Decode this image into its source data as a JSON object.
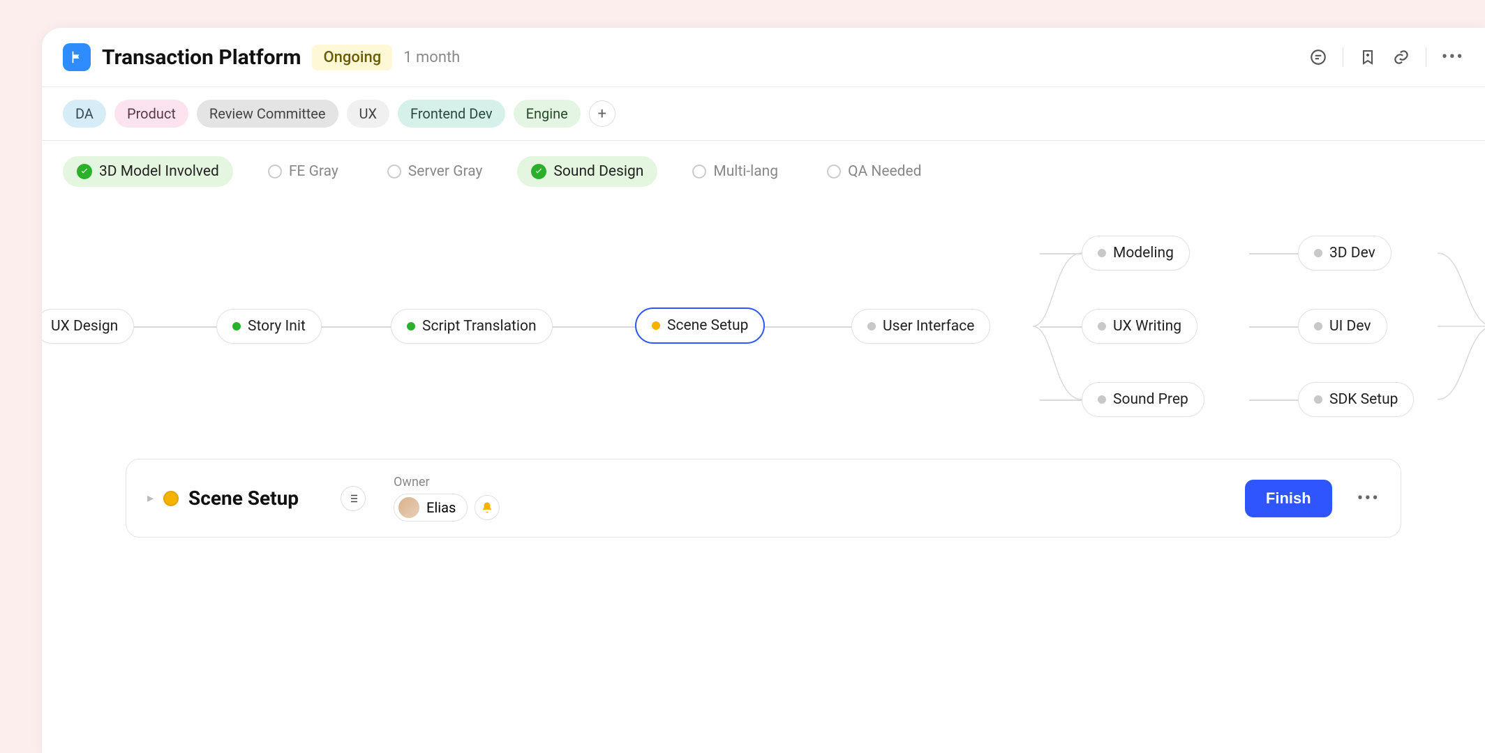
{
  "header": {
    "title": "Transaction Platform",
    "status": "Ongoing",
    "duration": "1 month"
  },
  "tags": {
    "da": "DA",
    "product": "Product",
    "review": "Review Committee",
    "ux": "UX",
    "fe": "Frontend Dev",
    "engine": "Engine"
  },
  "filters": {
    "model3d": "3D Model Involved",
    "fegray": "FE Gray",
    "servergray": "Server Gray",
    "sound": "Sound Design",
    "multilang": "Multi-lang",
    "qa": "QA Needed"
  },
  "nodes": {
    "uxdesign": "UX Design",
    "storyinit": "Story Init",
    "script": "Script Translation",
    "scene": "Scene Setup",
    "ui": "User Interface",
    "modeling": "Modeling",
    "uxwriting": "UX Writing",
    "soundprep": "Sound Prep",
    "dev3d": "3D Dev",
    "uidev": "UI Dev",
    "sdk": "SDK Setup"
  },
  "detail": {
    "title": "Scene Setup",
    "owner_label": "Owner",
    "owner_name": "Elias",
    "finish": "Finish"
  }
}
